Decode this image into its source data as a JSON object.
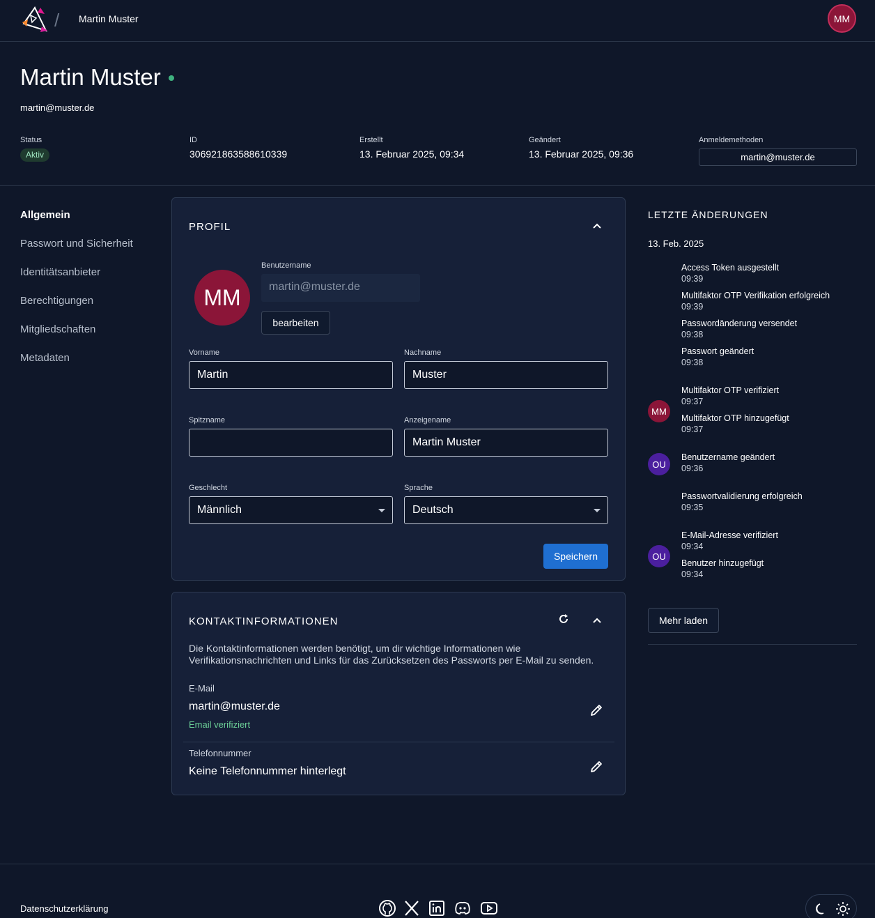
{
  "topbar": {
    "breadcrumb": "Martin Muster",
    "user_initials": "MM"
  },
  "header": {
    "name": "Martin Muster",
    "email": "martin@muster.de",
    "status_label": "Status",
    "status_value": "Aktiv",
    "id_label": "ID",
    "id_value": "306921863588610339",
    "created_label": "Erstellt",
    "created_value": "13. Februar 2025, 09:34",
    "changed_label": "Geändert",
    "changed_value": "13. Februar 2025, 09:36",
    "methods_label": "Anmeldemethoden",
    "methods_value": "martin@muster.de"
  },
  "nav": {
    "items": [
      {
        "label": "Allgemein"
      },
      {
        "label": "Passwort und Sicherheit"
      },
      {
        "label": "Identitätsanbieter"
      },
      {
        "label": "Berechtigungen"
      },
      {
        "label": "Mitgliedschaften"
      },
      {
        "label": "Metadaten"
      }
    ]
  },
  "profile": {
    "title": "PROFIL",
    "avatar_initials": "MM",
    "username_label": "Benutzername",
    "username_value": "martin@muster.de",
    "edit_label": "bearbeiten",
    "firstname_label": "Vorname",
    "firstname_value": "Martin",
    "lastname_label": "Nachname",
    "lastname_value": "Muster",
    "nickname_label": "Spitzname",
    "nickname_value": "",
    "displayname_label": "Anzeigename",
    "displayname_value": "Martin Muster",
    "gender_label": "Geschlecht",
    "gender_value": "Männlich",
    "language_label": "Sprache",
    "language_value": "Deutsch",
    "save_label": "Speichern"
  },
  "contact": {
    "title": "KONTAKTINFORMATIONEN",
    "description": "Die Kontaktinformationen werden benötigt, um dir wichtige Informationen wie Verifikationsnachrichten und Links für das Zurücksetzen des Passworts per E-Mail zu senden.",
    "email_label": "E-Mail",
    "email_value": "martin@muster.de",
    "email_status": "Email verifiziert",
    "phone_label": "Telefonnummer",
    "phone_value": "Keine Telefonnummer hinterlegt"
  },
  "activity": {
    "title": "LETZTE ÄNDERUNGEN",
    "date": "13. Feb. 2025",
    "entries": [
      {
        "text": "Access Token ausgestellt",
        "time": "09:39"
      },
      {
        "text": "Multifaktor OTP Verifikation erfolgreich",
        "time": "09:39"
      },
      {
        "text": "Passwordänderung versendet",
        "time": "09:38"
      },
      {
        "text": "Passwort geändert",
        "time": "09:38"
      },
      {
        "text": "Multifaktor OTP verifiziert",
        "time": "09:37"
      },
      {
        "text": "Multifaktor OTP hinzugefügt",
        "time": "09:37"
      },
      {
        "text": "Benutzername geändert",
        "time": "09:36"
      },
      {
        "text": "Passwortvalidierung erfolgreich",
        "time": "09:35"
      },
      {
        "text": "E-Mail-Adresse verifiziert",
        "time": "09:34"
      },
      {
        "text": "Benutzer hinzugefügt",
        "time": "09:34"
      }
    ],
    "avatars": [
      {
        "initials": "MM",
        "color": "#8b1538"
      },
      {
        "initials": "OU",
        "color": "#4b1f9e"
      },
      {
        "initials": "OU",
        "color": "#4b1f9e"
      }
    ],
    "load_more": "Mehr laden"
  },
  "footer": {
    "privacy": "Datenschutzerklärung"
  },
  "colors": {
    "background": "#0f1729",
    "card": "#162038",
    "primary": "#1f6fd1",
    "accent": "#8b1538",
    "success": "#3fb27f"
  }
}
